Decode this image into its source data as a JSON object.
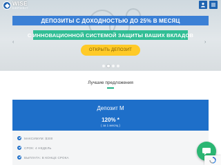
{
  "header": {
    "logo_name": "WISE",
    "logo_subtitle": "DEPOSIT"
  },
  "hero": {
    "headline": "ДЕПОЗИТЫ С ДОХОДНОСТЬЮ ДО 25% В МЕСЯЦ",
    "subheadline": "С ИННОВАЦИОННОЙ СИСТЕМОЙ ЗАЩИТЫ ВАШИХ ВКЛАДОВ",
    "cta_label": "ОТКРЫТЬ ДЕПОЗИТ",
    "prev_label": "‹",
    "next_label": "›",
    "slides_count": 4,
    "active_slide": 1
  },
  "offers": {
    "title": "Лучшие предложения",
    "plan": {
      "name": "Депозит M",
      "rate": "120% *",
      "period": "( за 1 месяц )",
      "features": [
        "МАКСИМУМ: $300",
        "СРОК: 4 НЕДЕЛЬ",
        "ВЫПЛАТА: В КОНЦЕ СРОКА"
      ]
    }
  },
  "colors": {
    "brand_blue": "#1e6fc9",
    "accent_green": "#21b384",
    "cta_yellow": "#ffca28"
  },
  "icons": {
    "user": "user-icon",
    "menu": "hamburger-menu-icon",
    "check": "check-circle-icon",
    "chat": "chat-bubble-icon",
    "recaptcha": "recaptcha-icon"
  }
}
